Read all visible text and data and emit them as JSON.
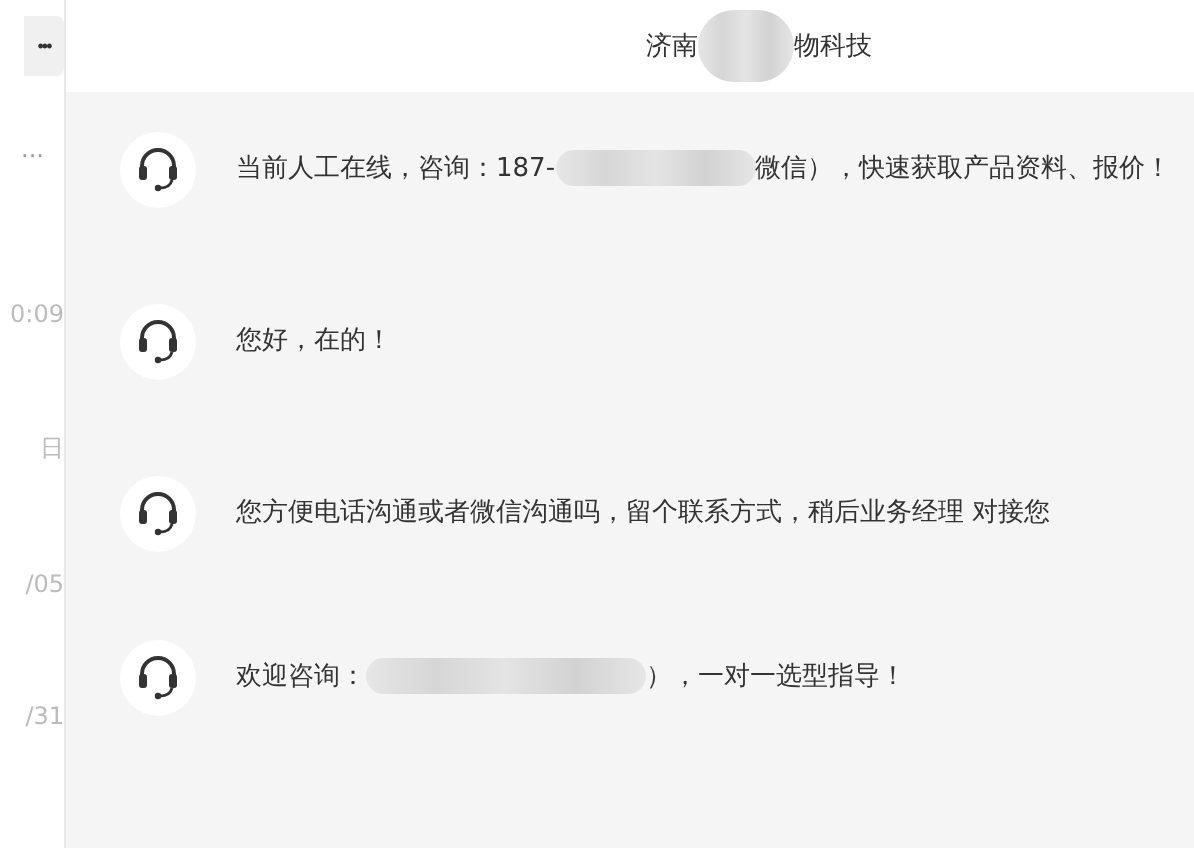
{
  "sidebar": {
    "menu_button": "•••",
    "more": "···",
    "times": [
      "0:09",
      "日",
      "/05",
      "/31"
    ]
  },
  "header": {
    "title": [
      {
        "kind": "text",
        "text": "济南"
      },
      {
        "kind": "redacted"
      },
      {
        "kind": "text",
        "text": "物科技"
      }
    ]
  },
  "messages": [
    {
      "parts": [
        {
          "kind": "text",
          "text": "当前人工在线，咨询：187-"
        },
        {
          "kind": "redacted"
        },
        {
          "kind": "text",
          "text": "微信），快速获取产品资料、报价！"
        }
      ]
    },
    {
      "parts": [
        {
          "kind": "text",
          "text": "您好，在的！"
        }
      ]
    },
    {
      "parts": [
        {
          "kind": "text",
          "text": "您方便电话沟通或者微信沟通吗，留个联系方式，稍后业务经理 对接您"
        }
      ]
    },
    {
      "parts": [
        {
          "kind": "text",
          "text": "欢迎咨询："
        },
        {
          "kind": "redacted"
        },
        {
          "kind": "text",
          "text": "），一对一选型指导！"
        }
      ]
    }
  ]
}
